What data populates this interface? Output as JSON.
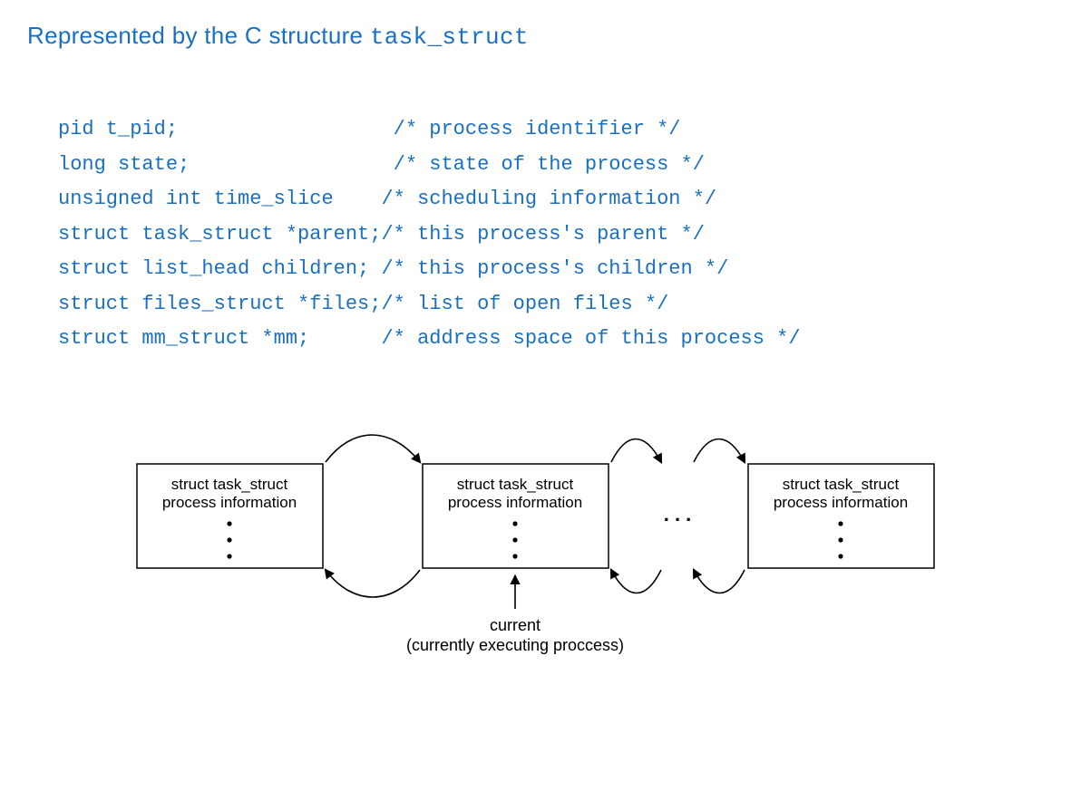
{
  "heading_prefix": "Represented by the C structure ",
  "heading_codeword": "task_struct",
  "code_lines": [
    "pid t_pid;                  /* process identifier */",
    "long state;                 /* state of the process */",
    "unsigned int time_slice    /* scheduling information */",
    "struct task_struct *parent;/* this process's parent */",
    "struct list_head children; /* this process's children */",
    "struct files_struct *files;/* list of open files */",
    "struct mm_struct *mm;      /* address space of this process */"
  ],
  "diagram": {
    "box_line1": "struct task_struct",
    "box_line2": "process information",
    "ellipsis": ". . .",
    "caption_line1": "current",
    "caption_line2": "(currently executing proccess)"
  }
}
